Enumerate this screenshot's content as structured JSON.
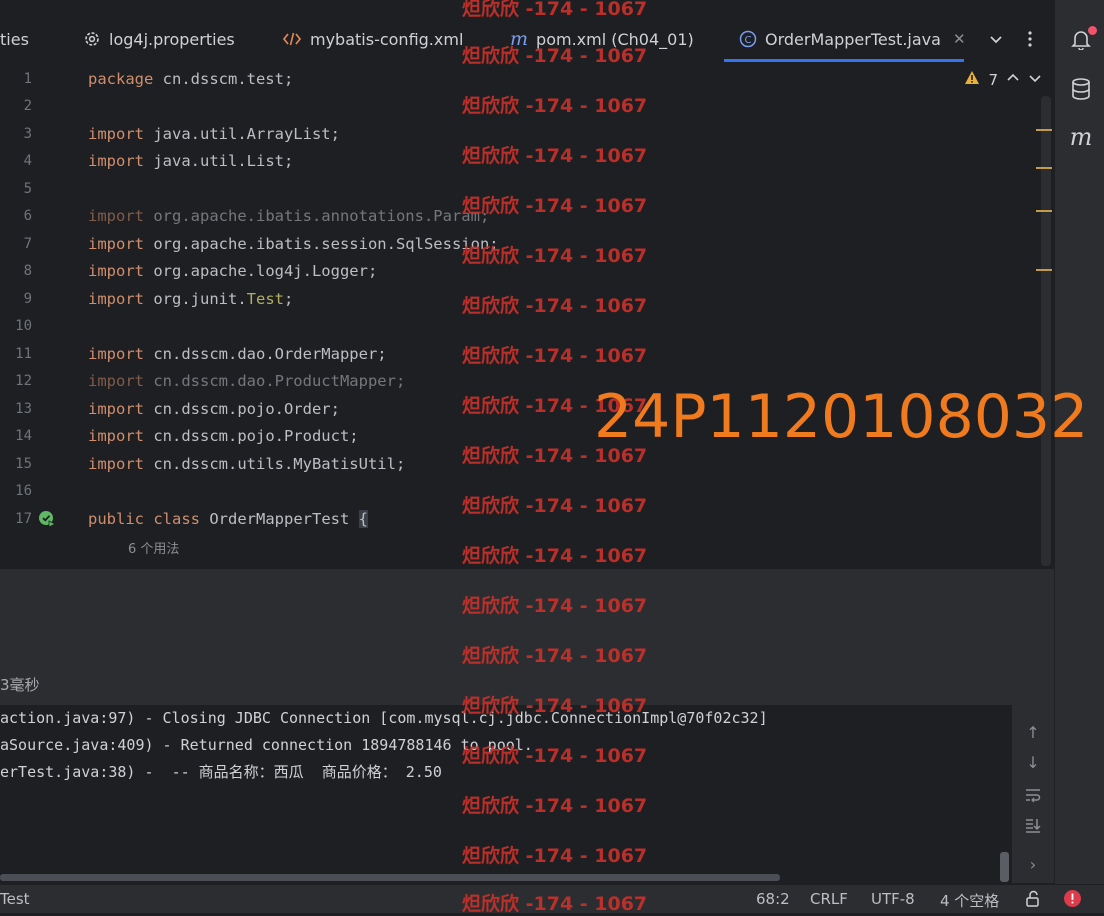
{
  "tabs": [
    {
      "label": "ties",
      "icon": "none"
    },
    {
      "label": "log4j.properties",
      "icon": "gear-icon"
    },
    {
      "label": "mybatis-config.xml",
      "icon": "xml-icon"
    },
    {
      "label": "pom.xml (Ch04_01)",
      "icon": "maven-icon"
    },
    {
      "label": "OrderMapperTest.java",
      "icon": "class-icon",
      "active": true
    }
  ],
  "inspection": {
    "warnings": "7"
  },
  "editor": {
    "line_numbers": [
      "1",
      "2",
      "3",
      "4",
      "5",
      "6",
      "7",
      "8",
      "9",
      "10",
      "11",
      "12",
      "13",
      "14",
      "15",
      "16",
      "17"
    ],
    "lines": {
      "l1_kw": "package",
      "l1_rest": " cn.dsscm.test;",
      "l3_kw": "import",
      "l3_rest": " java.util.ArrayList;",
      "l4_kw": "import",
      "l4_rest": " java.util.List;",
      "l6_kw": "import",
      "l6_rest": " org.apache.ibatis.annotations.Param;",
      "l7_kw": "import",
      "l7_rest": " org.apache.ibatis.session.SqlSession;",
      "l8_kw": "import",
      "l8_rest": " org.apache.log4j.Logger;",
      "l9_kw": "import",
      "l9_pre": " org.junit.",
      "l9_ann": "Test",
      "l9_post": ";",
      "l11_kw": "import",
      "l11_rest": " cn.dsscm.dao.OrderMapper;",
      "l12_kw": "import",
      "l12_rest": " cn.dsscm.dao.ProductMapper;",
      "l13_kw": "import",
      "l13_rest": " cn.dsscm.pojo.Order;",
      "l14_kw": "import",
      "l14_rest": " cn.dsscm.pojo.Product;",
      "l15_kw": "import",
      "l15_rest": " cn.dsscm.utils.MyBatisUtil;",
      "l17_kw1": "public",
      "l17_kw2": " class",
      "l17_name": " OrderMapperTest ",
      "l17_brace": "{"
    },
    "usage_hint": "6 个用法"
  },
  "test_status": "3毫秒",
  "console": [
    "action.java:97) - Closing JDBC Connection [com.mysql.cj.jdbc.ConnectionImpl@70f02c32]",
    "aSource.java:409) - Returned connection 1894788146 to pool.",
    "erTest.java:38) -  -- 商品名称：西瓜  商品价格： 2.50"
  ],
  "statusbar": {
    "left": "Test",
    "position": "68:2",
    "line_sep": "CRLF",
    "encoding": "UTF-8",
    "indent": "4 个空格"
  },
  "watermarks": {
    "repeat": "炟欣欣 -174 - 1067",
    "big": "24P1120108032"
  },
  "colors": {
    "accent": "#3574f0",
    "keyword": "#cf8e6d",
    "watermark_red": "#c8312a",
    "watermark_orange": "#f07a1e"
  }
}
